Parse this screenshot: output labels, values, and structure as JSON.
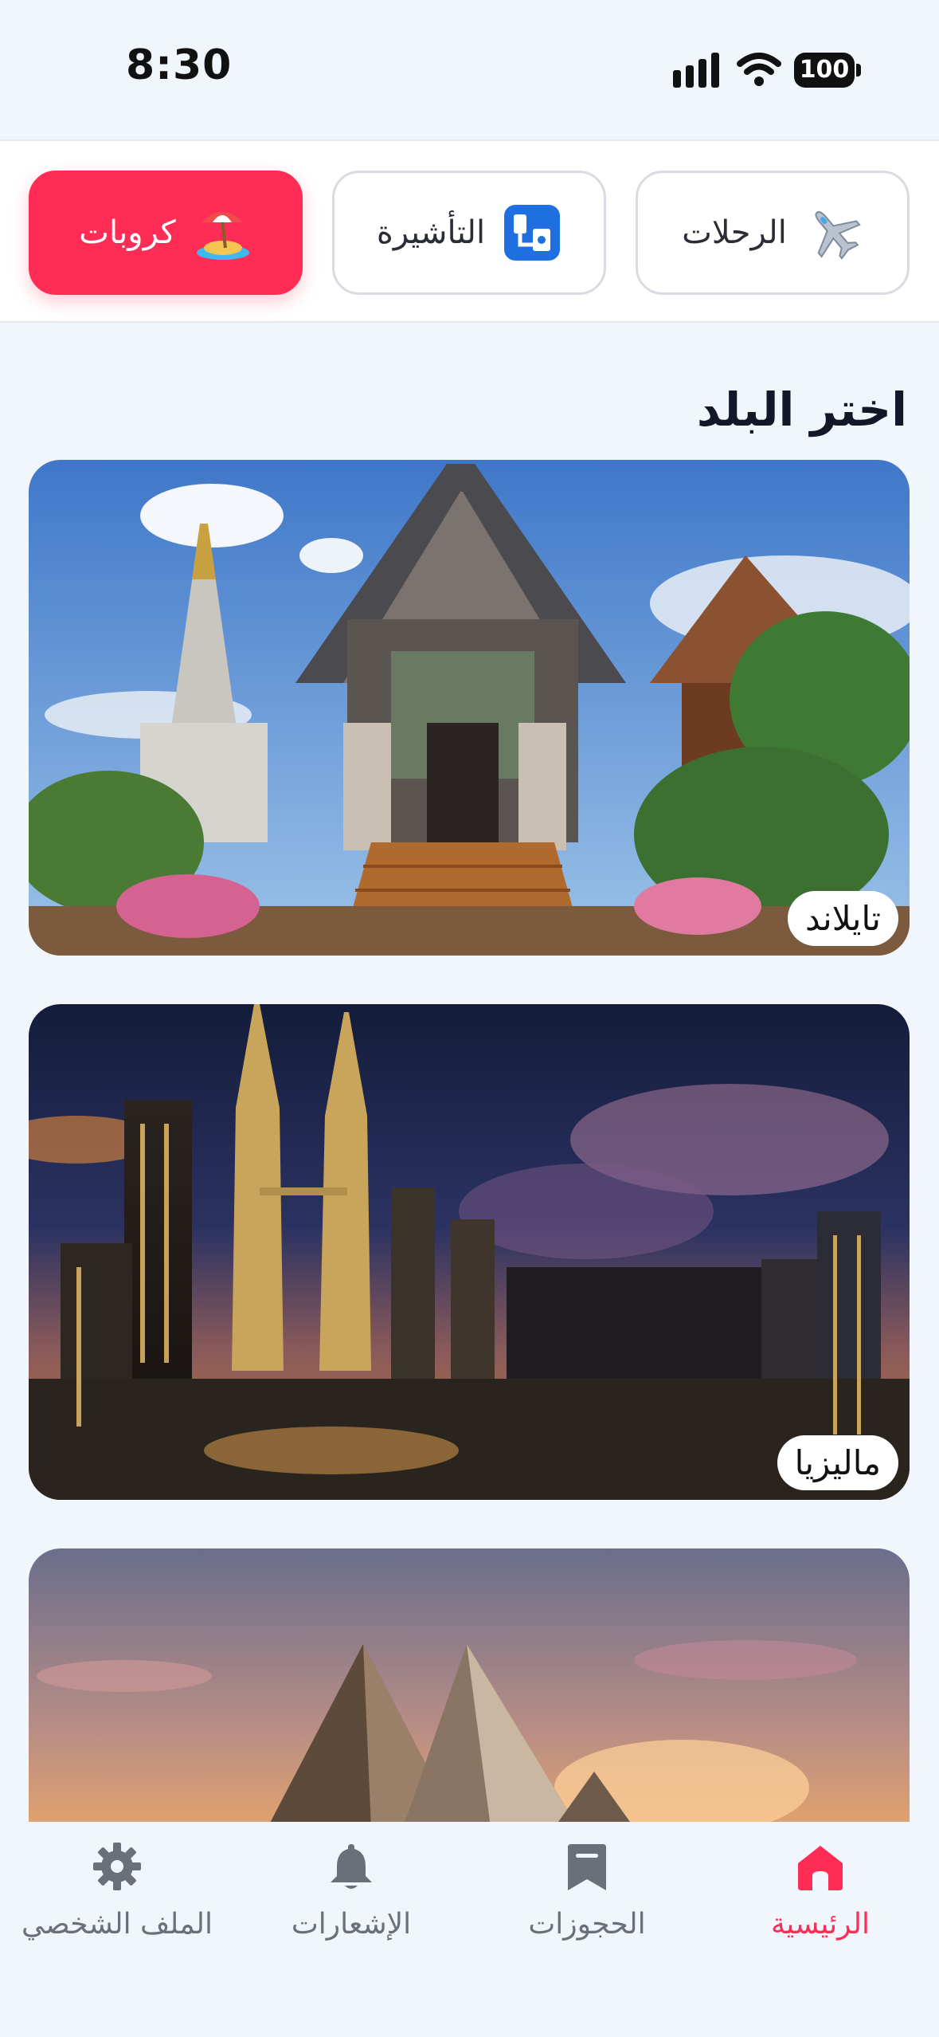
{
  "status_bar": {
    "time": "8:30",
    "battery": "100",
    "icons": [
      "signal-icon",
      "wifi-icon",
      "battery-icon"
    ]
  },
  "categories": [
    {
      "label": "الرحلات",
      "icon": "airplane-icon",
      "active": false
    },
    {
      "label": "التأشيرة",
      "icon": "passport-stamp-icon",
      "active": false
    },
    {
      "label": "كروبات",
      "icon": "beach-island-icon",
      "active": true
    }
  ],
  "section": {
    "title": "اختر البلد"
  },
  "countries": [
    {
      "name": "تايلاند",
      "image": "thai-temple-photo"
    },
    {
      "name": "ماليزيا",
      "image": "kuala-lumpur-skyline-photo"
    },
    {
      "name": "",
      "image": "egypt-pyramids-photo"
    }
  ],
  "bottom_nav": [
    {
      "label": "الرئيسية",
      "icon": "home-icon",
      "active": true
    },
    {
      "label": "الحجوزات",
      "icon": "bookmark-icon",
      "active": false
    },
    {
      "label": "الإشعارات",
      "icon": "bell-icon",
      "active": false
    },
    {
      "label": "الملف الشخصي",
      "icon": "gear-icon",
      "active": false
    }
  ],
  "colors": {
    "accent": "#ff2d55",
    "background": "#f1f5fc",
    "inactive_text": "#6b6f7a"
  }
}
